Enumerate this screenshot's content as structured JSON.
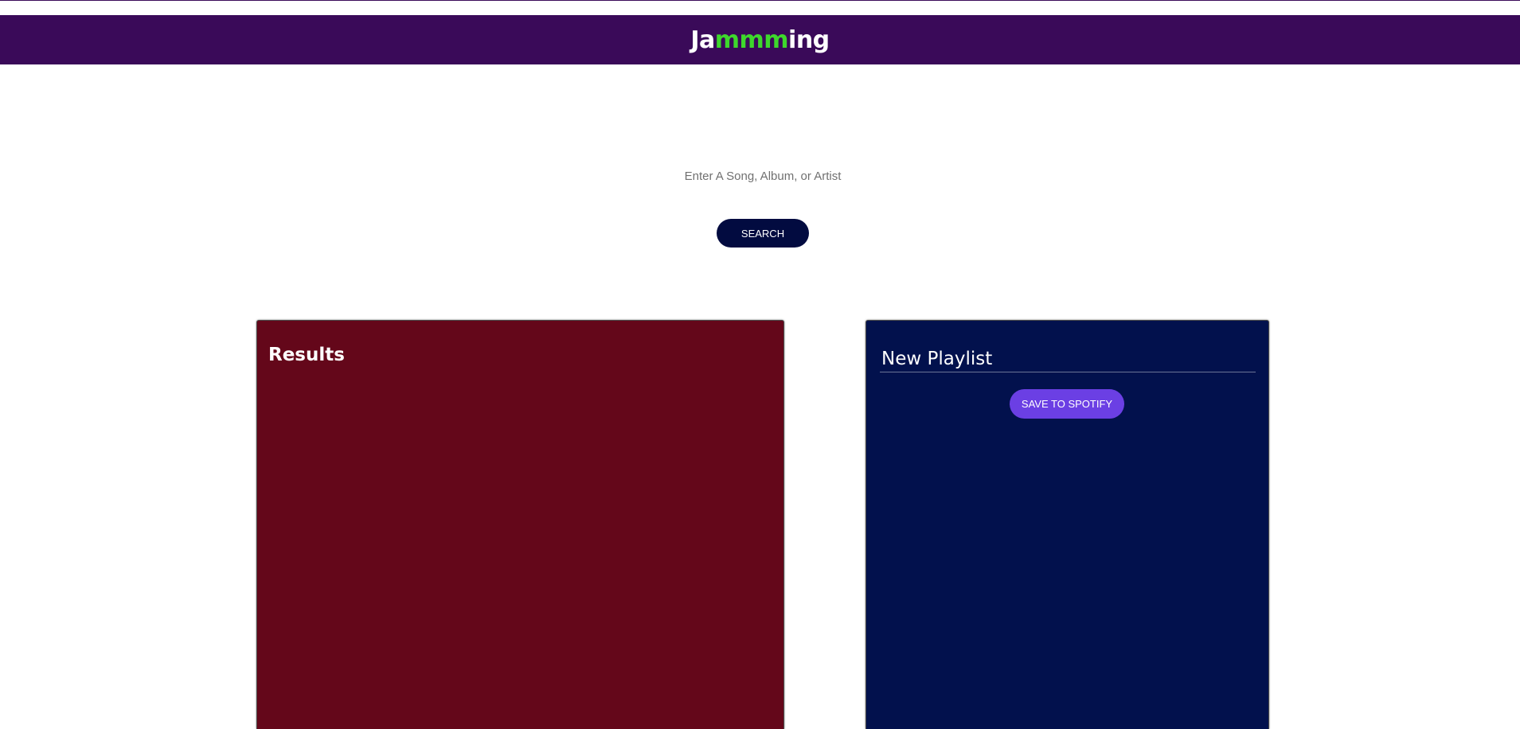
{
  "header": {
    "logo": {
      "part_1": "Ja",
      "part_2": "mmm",
      "part_3": "ing"
    }
  },
  "search": {
    "placeholder": "Enter A Song, Album, or Artist",
    "value": "",
    "button_label": "SEARCH"
  },
  "results": {
    "title": "Results"
  },
  "playlist": {
    "name": "New Playlist",
    "save_label": "SAVE TO SPOTIFY"
  },
  "colors": {
    "header_bg": "#3a0a59",
    "logo_accent": "#3ed82c",
    "search_button_bg": "#020b40",
    "results_bg": "#64071a",
    "playlist_bg": "#02114d",
    "save_button_bg": "#6b3fe4"
  }
}
